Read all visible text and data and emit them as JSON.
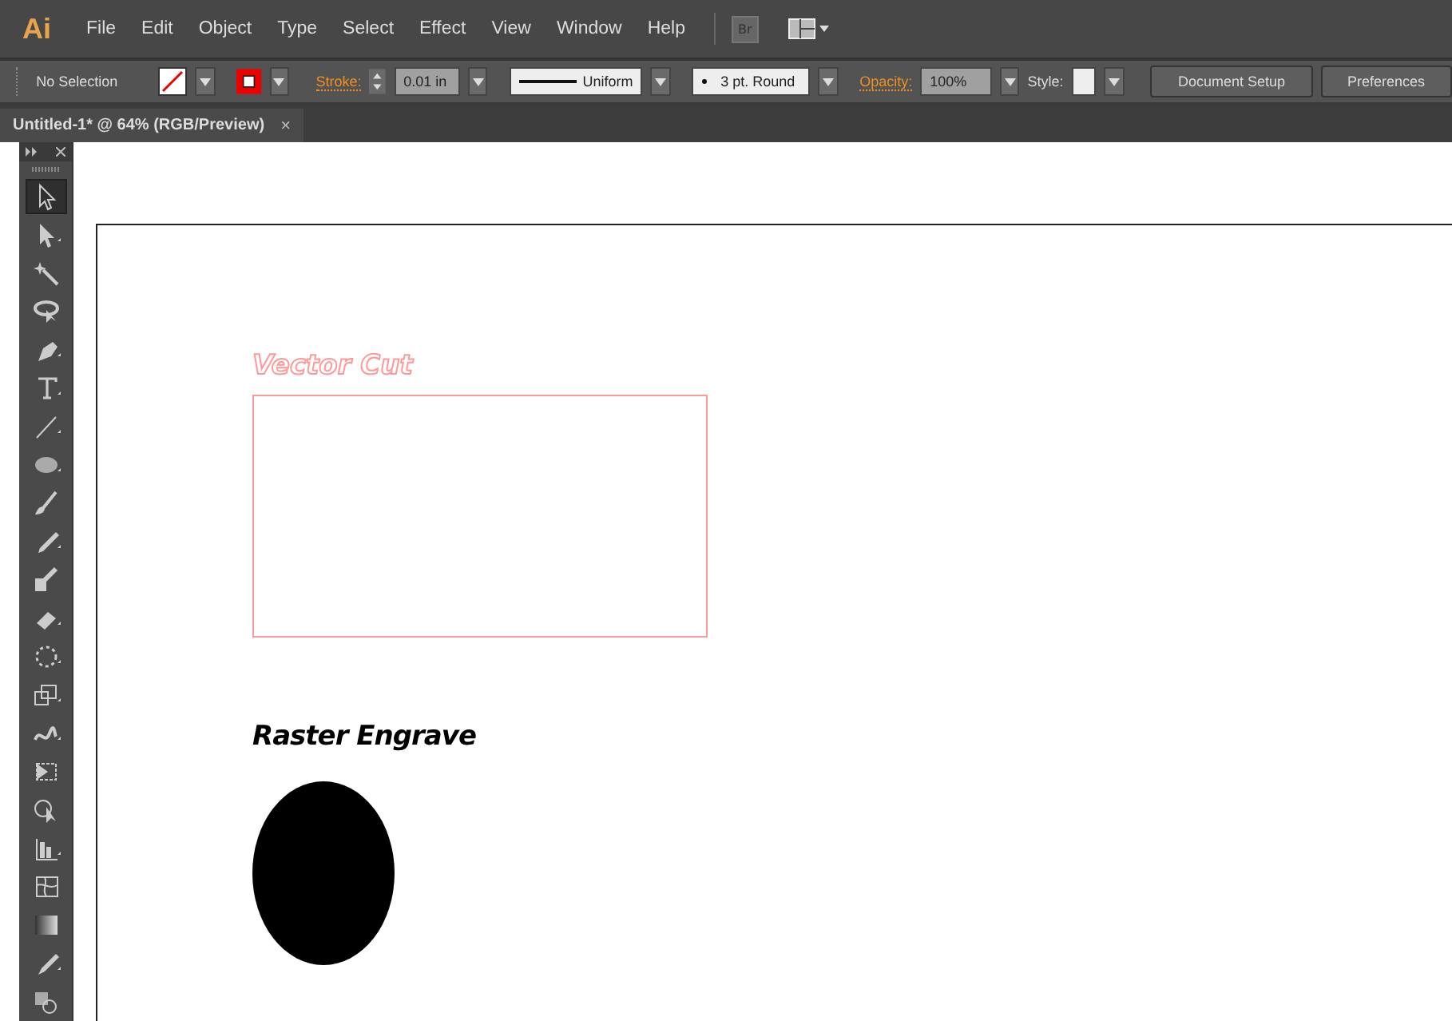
{
  "menu_bar": {
    "logo": "Ai",
    "items": [
      "File",
      "Edit",
      "Object",
      "Type",
      "Select",
      "Effect",
      "View",
      "Window",
      "Help"
    ],
    "bridge": "Br"
  },
  "control_bar": {
    "selection": "No Selection",
    "stroke_label": "Stroke:",
    "stroke_weight": "0.01 in",
    "profile": "Uniform",
    "brush": "3 pt. Round",
    "opacity_label": "Opacity:",
    "opacity": "100%",
    "style_label": "Style:",
    "buttons": [
      "Document Setup",
      "Preferences"
    ]
  },
  "document_tab": {
    "title": "Untitled-1* @ 64% (RGB/Preview)",
    "close": "×"
  },
  "tools": [
    {
      "kind": "selection",
      "selected": true
    },
    {
      "kind": "direct",
      "selected": false
    },
    {
      "kind": "wand",
      "selected": false
    },
    {
      "kind": "lasso",
      "selected": false
    },
    {
      "kind": "pen",
      "selected": false
    },
    {
      "kind": "type",
      "selected": false
    },
    {
      "kind": "line",
      "selected": false
    },
    {
      "kind": "ellipse",
      "selected": false
    },
    {
      "kind": "brush",
      "selected": false
    },
    {
      "kind": "pencil",
      "selected": false
    },
    {
      "kind": "blob",
      "selected": false
    },
    {
      "kind": "eraser",
      "selected": false
    },
    {
      "kind": "rotate",
      "selected": false
    },
    {
      "kind": "scale",
      "selected": false
    },
    {
      "kind": "warp",
      "selected": false
    },
    {
      "kind": "transform",
      "selected": false
    },
    {
      "kind": "shapebuilder",
      "selected": false
    },
    {
      "kind": "graph",
      "selected": false
    },
    {
      "kind": "mesh",
      "selected": false
    },
    {
      "kind": "gradient",
      "selected": false
    },
    {
      "kind": "eyedropper",
      "selected": false
    },
    {
      "kind": "blend",
      "selected": false
    }
  ],
  "artboard": {
    "objects": [
      {
        "kind": "outline_text",
        "text": "Vector Cut"
      },
      {
        "kind": "rectangle",
        "color": "#ff9999"
      },
      {
        "kind": "text",
        "text": "Raster Engrave",
        "color": "#000000"
      },
      {
        "kind": "ellipse",
        "color": "#000000"
      }
    ]
  }
}
